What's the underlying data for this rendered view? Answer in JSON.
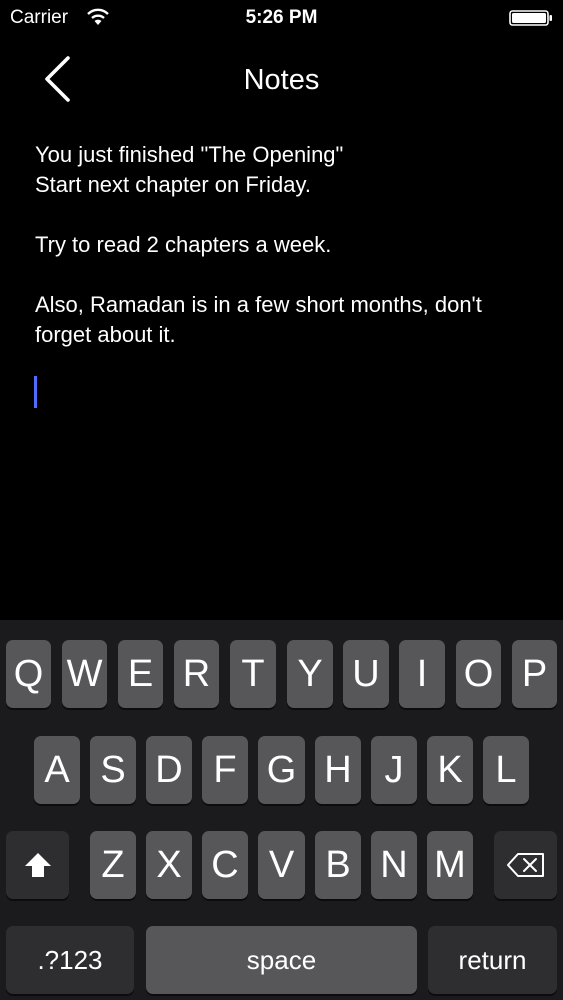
{
  "status": {
    "carrier": "Carrier",
    "time": "5:26 PM"
  },
  "nav": {
    "title": "Notes",
    "back_icon": "chevron-left-icon"
  },
  "note": {
    "lines": [
      "You just finished \"The Opening\"",
      "Start next chapter on Friday.",
      "",
      "Try to read 2 chapters a week.",
      "",
      "Also, Ramadan is in a few short months, don't",
      "forget about it."
    ]
  },
  "keyboard": {
    "row1": [
      "Q",
      "W",
      "E",
      "R",
      "T",
      "Y",
      "U",
      "I",
      "O",
      "P"
    ],
    "row2": [
      "A",
      "S",
      "D",
      "F",
      "G",
      "H",
      "J",
      "K",
      "L"
    ],
    "row3": [
      "Z",
      "X",
      "C",
      "V",
      "B",
      "N",
      "M"
    ],
    "numbers_label": ".?123",
    "space_label": "space",
    "return_label": "return",
    "shift_icon": "shift-arrow-icon",
    "delete_icon": "backspace-icon"
  },
  "colors": {
    "cursor": "#4f6cff",
    "key": "#575759",
    "key_dark": "#2e2e30",
    "keyboard_bg": "#1b1b1d"
  }
}
